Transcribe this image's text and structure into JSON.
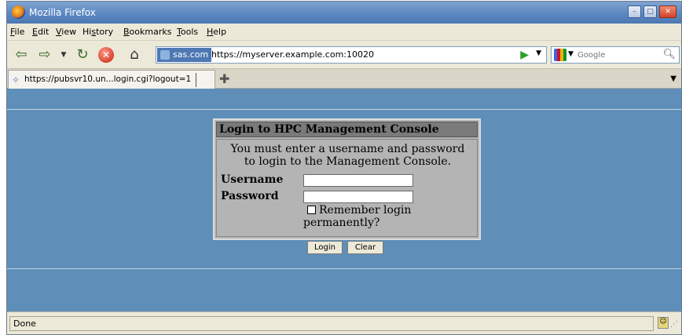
{
  "window": {
    "title": "Mozilla Firefox"
  },
  "menu": [
    "File",
    "Edit",
    "View",
    "History",
    "Bookmarks",
    "Tools",
    "Help"
  ],
  "menu_access_keys": [
    "F",
    "E",
    "V",
    "s",
    "B",
    "T",
    "H"
  ],
  "toolbar": {
    "site_label": "sas.com",
    "url": "https://myserver.example.com:10020",
    "search_placeholder": "Google"
  },
  "tabs": [
    {
      "label": "https://pubsvr10.un...login.cgi?logout=1"
    }
  ],
  "login": {
    "heading": "Login to HPC Management Console",
    "message_line1": "You must enter a username and password",
    "message_line2": "to login to the Management Console.",
    "username_label": "Username",
    "username_value": "",
    "password_label": "Password",
    "password_value": "",
    "remember_label_line1": "Remember login",
    "remember_label_line2": "permanently?",
    "remember_checked": false,
    "login_button": "Login",
    "clear_button": "Clear"
  },
  "status": {
    "text": "Done"
  },
  "colors": {
    "content_bg": "#5f8fb8",
    "login_box_bg": "#b4b4b4",
    "login_header_bg": "#7a7a7a",
    "titlebar": "#5c88c2"
  }
}
